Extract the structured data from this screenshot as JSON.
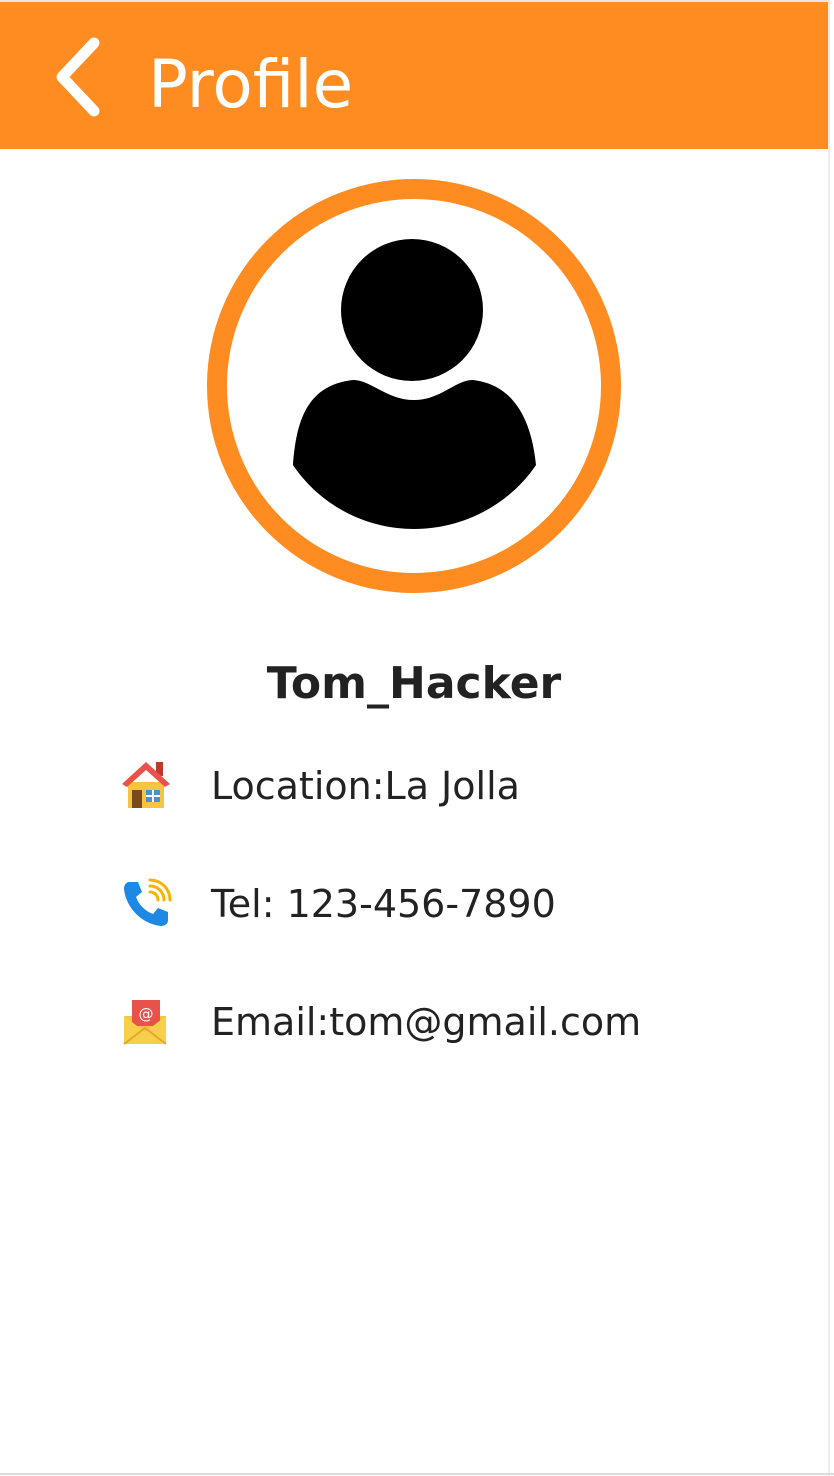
{
  "header": {
    "title": "Profile",
    "back_icon": "chevron-left-icon",
    "background": "#ff8c21"
  },
  "profile": {
    "avatar_icon": "user-icon",
    "avatar_ring_color": "#ff8c21",
    "username": "Tom_Hacker"
  },
  "details": [
    {
      "icon": "house-icon",
      "text": "Location:La Jolla"
    },
    {
      "icon": "phone-icon",
      "text": "Tel: 123-456-7890"
    },
    {
      "icon": "email-icon",
      "text": "Email:tom@gmail.com"
    }
  ]
}
